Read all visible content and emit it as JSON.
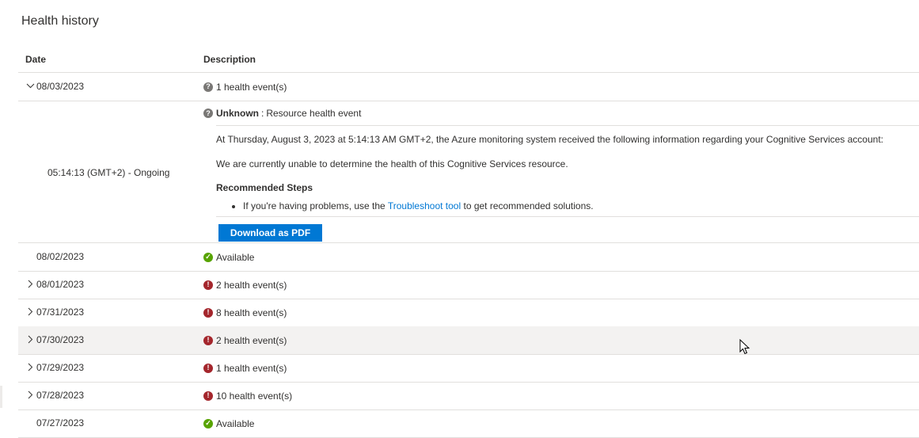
{
  "title": "Health history",
  "columns": {
    "date": "Date",
    "description": "Description"
  },
  "expanded_row": {
    "date": "08/03/2023",
    "chevron": "chevron-down-icon",
    "status_icon": "unknown-icon",
    "description": "1 health event(s)"
  },
  "event": {
    "time": "05:14:13 (GMT+2) - Ongoing",
    "status_icon": "unknown-icon",
    "status": "Unknown",
    "separator": ":",
    "type": "Resource health event",
    "message": "At Thursday, August 3, 2023 at 5:14:13 AM GMT+2, the Azure monitoring system received the following information regarding your Cognitive Services account:",
    "detail": "We are currently unable to determine the health of this Cognitive Services resource.",
    "recommended_title": "Recommended Steps",
    "step_prefix": "If you're having problems, use the",
    "step_link": "Troubleshoot tool",
    "step_suffix": "to get recommended solutions.",
    "download_label": "Download as PDF"
  },
  "rows": [
    {
      "date": "08/02/2023",
      "chevron": "",
      "status": "available",
      "description": "Available"
    },
    {
      "date": "08/01/2023",
      "chevron": "chevron-right-icon",
      "status": "error",
      "description": "2 health event(s)"
    },
    {
      "date": "07/31/2023",
      "chevron": "chevron-right-icon",
      "status": "error",
      "description": "8 health event(s)"
    },
    {
      "date": "07/30/2023",
      "chevron": "chevron-right-icon",
      "status": "error",
      "description": "2 health event(s)"
    },
    {
      "date": "07/29/2023",
      "chevron": "chevron-right-icon",
      "status": "error",
      "description": "1 health event(s)"
    },
    {
      "date": "07/28/2023",
      "chevron": "chevron-right-icon",
      "status": "error",
      "description": "10 health event(s)"
    },
    {
      "date": "07/27/2023",
      "chevron": "",
      "status": "available",
      "description": "Available"
    }
  ],
  "colors": {
    "accent": "#0078d4",
    "error": "#a4262c",
    "available": "#57a300",
    "unknown": "#797775",
    "hover_row": "#f3f2f1"
  }
}
